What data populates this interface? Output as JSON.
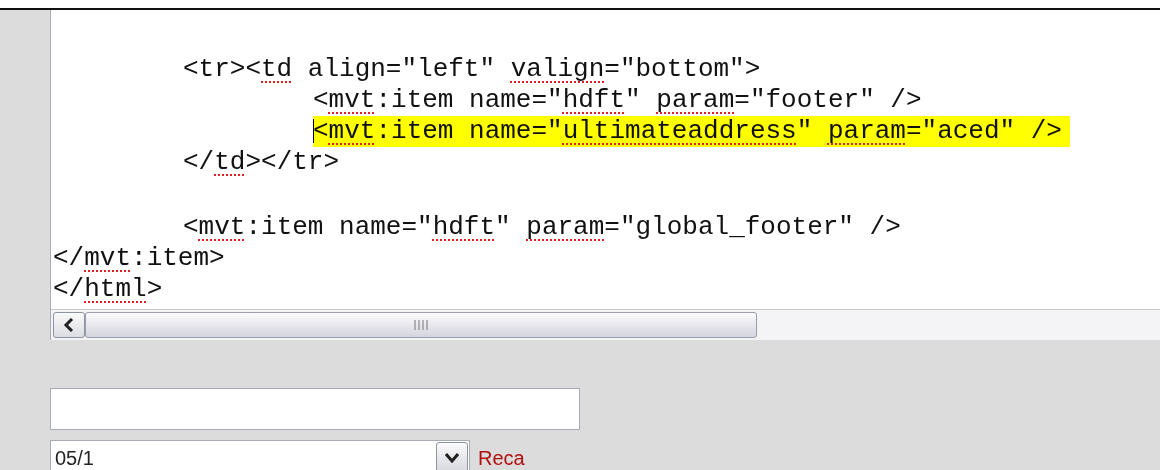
{
  "editor": {
    "lines": [
      {
        "kind": "block",
        "children": [
          {
            "kind": "code",
            "highlighted": false,
            "caret": false,
            "segments": [
              {
                "text": "<tr><",
                "flagged": false
              },
              {
                "text": "td",
                "flagged": true
              },
              {
                "text": " align=\"left\" ",
                "flagged": false
              },
              {
                "text": "valign",
                "flagged": true
              },
              {
                "text": "=\"bottom\">",
                "flagged": false
              }
            ],
            "children": [
              {
                "kind": "code",
                "highlighted": false,
                "caret": false,
                "segments": [
                  {
                    "text": "<",
                    "flagged": false
                  },
                  {
                    "text": "mvt",
                    "flagged": true
                  },
                  {
                    "text": ":item name=\"",
                    "flagged": false
                  },
                  {
                    "text": "hdft",
                    "flagged": true
                  },
                  {
                    "text": "\" ",
                    "flagged": false
                  },
                  {
                    "text": "param",
                    "flagged": true
                  },
                  {
                    "text": "=\"footer\" />",
                    "flagged": false
                  }
                ]
              },
              {
                "kind": "code",
                "highlighted": true,
                "caret": true,
                "segments": [
                  {
                    "text": "<",
                    "flagged": false
                  },
                  {
                    "text": "mvt",
                    "flagged": true
                  },
                  {
                    "text": ":item name=\"",
                    "flagged": false
                  },
                  {
                    "text": "ultimateaddress",
                    "flagged": true
                  },
                  {
                    "text": "\" ",
                    "flagged": false
                  },
                  {
                    "text": "param",
                    "flagged": true
                  },
                  {
                    "text": "=\"aced\" />",
                    "flagged": false
                  }
                ]
              }
            ]
          },
          {
            "kind": "code",
            "highlighted": false,
            "caret": false,
            "segments": [
              {
                "text": "</",
                "flagged": false
              },
              {
                "text": "td",
                "flagged": true
              },
              {
                "text": "></tr>",
                "flagged": false
              }
            ]
          },
          {
            "kind": "blank"
          },
          {
            "kind": "code",
            "highlighted": false,
            "caret": false,
            "segments": [
              {
                "text": "<",
                "flagged": false
              },
              {
                "text": "mvt",
                "flagged": true
              },
              {
                "text": ":item name=\"",
                "flagged": false
              },
              {
                "text": "hdft",
                "flagged": true
              },
              {
                "text": "\" ",
                "flagged": false
              },
              {
                "text": "param",
                "flagged": true
              },
              {
                "text": "=\"global_footer\" />",
                "flagged": false
              }
            ]
          }
        ]
      },
      {
        "kind": "code",
        "highlighted": false,
        "caret": false,
        "segments": [
          {
            "text": "</",
            "flagged": false
          },
          {
            "text": "mvt",
            "flagged": true
          },
          {
            "text": ":item>",
            "flagged": false
          }
        ]
      },
      {
        "kind": "code",
        "highlighted": false,
        "caret": false,
        "segments": [
          {
            "text": "</",
            "flagged": false
          },
          {
            "text": "html",
            "flagged": true
          },
          {
            "text": ">",
            "flagged": false
          }
        ]
      }
    ]
  },
  "date_dropdown": {
    "value": "05/1"
  },
  "status_link": "Reca"
}
